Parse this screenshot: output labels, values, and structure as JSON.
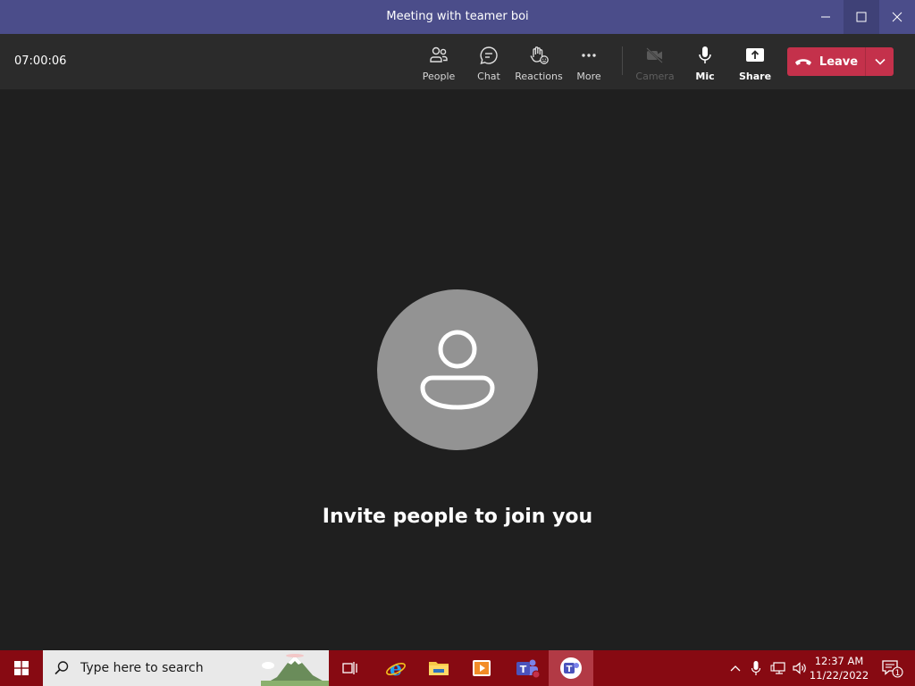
{
  "window": {
    "title": "Meeting with teamer boi"
  },
  "toolbar": {
    "timer": "07:00:06",
    "people_label": "People",
    "chat_label": "Chat",
    "reactions_label": "Reactions",
    "more_label": "More",
    "camera_label": "Camera",
    "mic_label": "Mic",
    "share_label": "Share",
    "leave_label": "Leave"
  },
  "stage": {
    "message": "Invite people to join you"
  },
  "taskbar": {
    "search_placeholder": "Type here to search",
    "time": "12:37 AM",
    "date": "11/22/2022",
    "notification_count": "1"
  },
  "colors": {
    "titlebar": "#4b4d8a",
    "toolbar": "#2b2b2b",
    "stage": "#1f1f1f",
    "leave_button": "#c4314b",
    "avatar": "#939393",
    "taskbar": "#870a12"
  }
}
